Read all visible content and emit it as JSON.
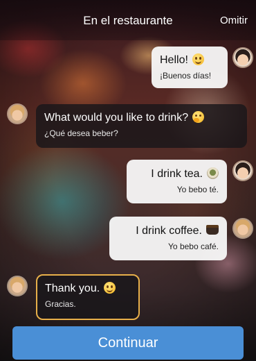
{
  "header": {
    "title": "En el restaurante",
    "skip_label": "Omitir"
  },
  "messages": [
    {
      "speaker": "woman",
      "text": "Hello!",
      "translation": "¡Buenos días!",
      "emoji": "smiling-face"
    },
    {
      "speaker": "man",
      "text": "What would you like to drink?",
      "translation": "¿Qué desea beber?",
      "emoji": "thinking-face"
    },
    {
      "speaker": "woman",
      "text": "I drink tea.",
      "translation": "Yo bebo té.",
      "emoji": "tea"
    },
    {
      "speaker": "man",
      "text": "I drink coffee.",
      "translation": "Yo bebo café.",
      "emoji": "coffee"
    },
    {
      "speaker": "man",
      "text": "Thank you.",
      "translation": "Gracias.",
      "emoji": "smiling-face"
    }
  ],
  "continue_label": "Continuar",
  "colors": {
    "continue_button": "#4a8fd6",
    "highlight_border": "#e8b04a",
    "light_bubble": "#f8f8f8",
    "dark_bubble": "#19161a"
  }
}
